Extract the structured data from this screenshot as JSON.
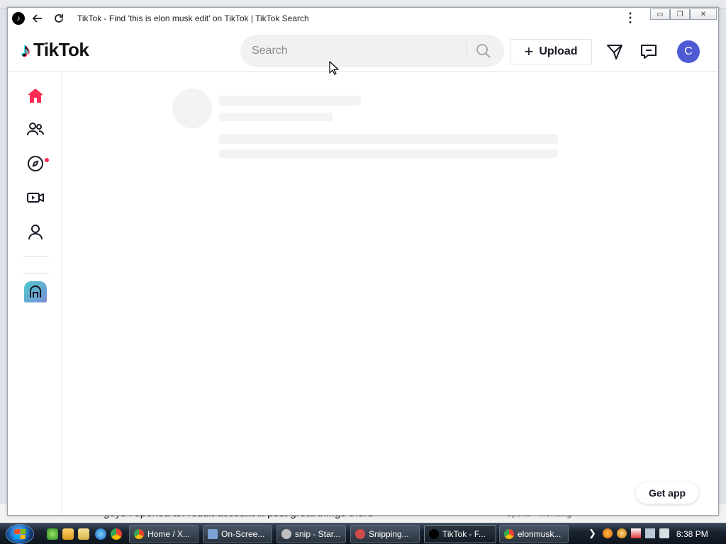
{
  "window": {
    "title": "TikTok - Find 'this is elon musk edit' on TikTok | TikTok Search",
    "menu_glyph": "⋮",
    "min_glyph": "▭",
    "restore_glyph": "❐",
    "close_glyph": "✕"
  },
  "header": {
    "logo_text": "TikTok",
    "search_placeholder": "Search",
    "upload_plus": "+",
    "upload_label": "Upload",
    "avatar_initial": "C"
  },
  "sidebar": {
    "items": [
      {
        "name": "home",
        "active": true
      },
      {
        "name": "following"
      },
      {
        "name": "explore",
        "notification_dot": true
      },
      {
        "name": "live"
      },
      {
        "name": "profile"
      }
    ]
  },
  "footer": {
    "get_app_label": "Get app"
  },
  "background_page": {
    "partial_text": "guys i opened an reddit account ill post great things there",
    "partial_meta": "Sports · Trending"
  },
  "taskbar": {
    "tasks": [
      {
        "label": "Home / X...",
        "icon_color": "#e8453c"
      },
      {
        "label": "On-Scree...",
        "icon_color": "#7da2d6"
      },
      {
        "label": "snip - Star...",
        "icon_color": "#c0c0c0"
      },
      {
        "label": "Snipping...",
        "icon_color": "#d04a4a"
      },
      {
        "label": "TikTok - F...",
        "icon_color": "#000000"
      },
      {
        "label": "elonmusk...",
        "icon_color": "#e8453c"
      }
    ],
    "tray_arrow": "❯",
    "clock": "8:38 PM"
  },
  "colors": {
    "accent": "#fe2c55",
    "avatar_bg": "#4f5bd5",
    "text_primary": "#161823"
  }
}
